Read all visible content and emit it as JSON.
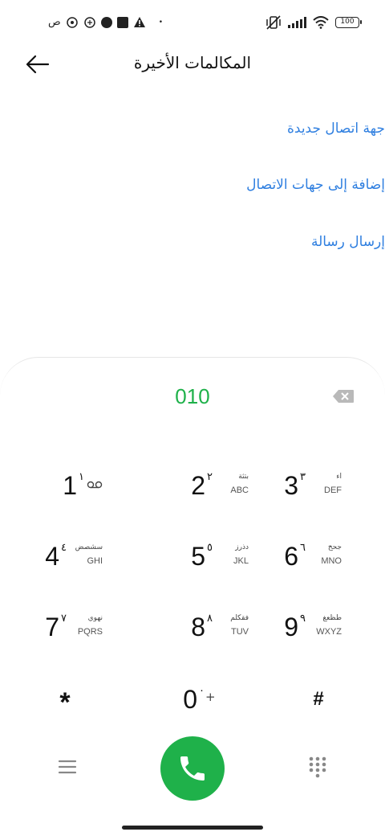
{
  "status_bar": {
    "left_text": "ص",
    "battery": "100",
    "dot": "•"
  },
  "header": {
    "title": "المكالمات الأخيرة"
  },
  "actions": [
    {
      "label": "جهة اتصال جديدة"
    },
    {
      "label": "إضافة إلى جهات الاتصال"
    },
    {
      "label": "إرسال رسالة"
    }
  ],
  "dialer": {
    "number": "010",
    "accent_color": "#1fb14a",
    "link_color": "#2f7fe0"
  },
  "keys": [
    {
      "digit": "1",
      "arabic_digit": "١",
      "arabic": "",
      "letters": "",
      "icon": "voicemail-icon"
    },
    {
      "digit": "2",
      "arabic_digit": "٢",
      "arabic": "بتثة",
      "letters": "ABC"
    },
    {
      "digit": "3",
      "arabic_digit": "٣",
      "arabic": "اء",
      "letters": "DEF"
    },
    {
      "digit": "4",
      "arabic_digit": "٤",
      "arabic": "سشصض",
      "letters": "GHI"
    },
    {
      "digit": "5",
      "arabic_digit": "٥",
      "arabic": "دذرز",
      "letters": "JKL"
    },
    {
      "digit": "6",
      "arabic_digit": "٦",
      "arabic": "جحخ",
      "letters": "MNO"
    },
    {
      "digit": "7",
      "arabic_digit": "٧",
      "arabic": "نهوي",
      "letters": "PQRS"
    },
    {
      "digit": "8",
      "arabic_digit": "٨",
      "arabic": "فقكلم",
      "letters": "TUV"
    },
    {
      "digit": "9",
      "arabic_digit": "٩",
      "arabic": "طظعغ",
      "letters": "WXYZ"
    },
    {
      "symbol": "*"
    },
    {
      "digit": "0",
      "arabic_digit": "٠",
      "plus": "+"
    },
    {
      "symbol": "#"
    }
  ]
}
